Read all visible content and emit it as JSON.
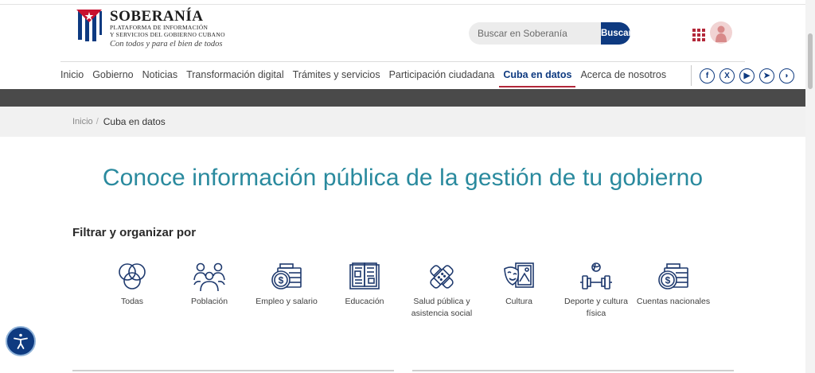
{
  "brand": {
    "name": "SOBERANÍA",
    "sub1": "PLATAFORMA DE INFORMACIÓN",
    "sub2": "Y SERVICIOS DEL GOBIERNO CUBANO",
    "slogan": "Con todos y para el bien de todos"
  },
  "search": {
    "placeholder": "Buscar en Soberanía",
    "button": "Buscar"
  },
  "nav": {
    "items": [
      {
        "label": "Inicio"
      },
      {
        "label": "Gobierno"
      },
      {
        "label": "Noticias"
      },
      {
        "label": "Transformación digital"
      },
      {
        "label": "Trámites y servicios"
      },
      {
        "label": "Participación ciudadana"
      },
      {
        "label": "Cuba en datos"
      },
      {
        "label": "Acerca de nosotros"
      }
    ],
    "active": "Cuba en datos"
  },
  "social": {
    "icons": [
      "facebook-icon",
      "x-icon",
      "youtube-icon",
      "telegram-icon",
      "podcast-icon"
    ]
  },
  "breadcrumb": {
    "home": "Inicio",
    "separator": "/",
    "current": "Cuba en datos"
  },
  "hero": {
    "title": "Conoce información pública de la gestión de tu gobierno"
  },
  "filters": {
    "title": "Filtrar y organizar por",
    "items": [
      {
        "label": "Todas",
        "icon": "venn-circles-icon"
      },
      {
        "label": "Población",
        "icon": "people-group-icon"
      },
      {
        "label": "Empleo y salario",
        "icon": "money-wallet-icon"
      },
      {
        "label": "Educación",
        "icon": "open-book-icon"
      },
      {
        "label": "Salud pública y asistencia social",
        "icon": "bandage-icon"
      },
      {
        "label": "Cultura",
        "icon": "theater-masks-icon"
      },
      {
        "label": "Deporte y cultura física",
        "icon": "sports-dumbbell-icon"
      },
      {
        "label": "Cuentas nacionales",
        "icon": "money-wallet-icon"
      }
    ]
  },
  "colors": {
    "primary": "#0e3a80",
    "accent": "#b3283a",
    "title": "#2a8a9e"
  }
}
